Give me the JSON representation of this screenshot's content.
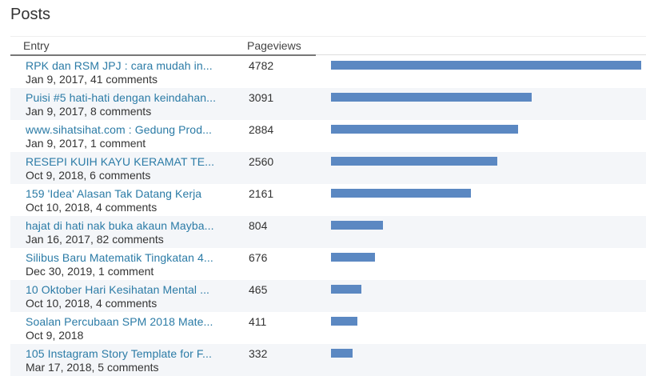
{
  "page": {
    "title": "Posts"
  },
  "table": {
    "col_entry": "Entry",
    "col_pageviews": "Pageviews",
    "bar_color": "#5b88c2",
    "link_color": "#2b7ba6",
    "max_pageviews": 4782
  },
  "posts": [
    {
      "title": "RPK dan RSM JPJ : cara mudah in...",
      "meta": "Jan 9, 2017, 41 comments",
      "pageviews": 4782
    },
    {
      "title": "Puisi #5 hati-hati dengan keindahan...",
      "meta": "Jan 9, 2017, 8 comments",
      "pageviews": 3091
    },
    {
      "title": "www.sihatsihat.com : Gedung Prod...",
      "meta": "Jan 9, 2017, 1 comment",
      "pageviews": 2884
    },
    {
      "title": "RESEPI KUIH KAYU KERAMAT TE...",
      "meta": "Oct 9, 2018, 6 comments",
      "pageviews": 2560
    },
    {
      "title": "159 'Idea' Alasan Tak Datang Kerja",
      "meta": "Oct 10, 2018, 4 comments",
      "pageviews": 2161
    },
    {
      "title": "hajat di hati nak buka akaun Mayba...",
      "meta": "Jan 16, 2017, 82 comments",
      "pageviews": 804
    },
    {
      "title": "Silibus Baru Matematik Tingkatan 4...",
      "meta": "Dec 30, 2019, 1 comment",
      "pageviews": 676
    },
    {
      "title": "10 Oktober Hari Kesihatan Mental ...",
      "meta": "Oct 10, 2018, 4 comments",
      "pageviews": 465
    },
    {
      "title": "Soalan Percubaan SPM 2018 Mate...",
      "meta": "Oct 9, 2018",
      "pageviews": 411
    },
    {
      "title": "105 Instagram Story Template for F...",
      "meta": "Mar 17, 2018, 5 comments",
      "pageviews": 332
    }
  ]
}
